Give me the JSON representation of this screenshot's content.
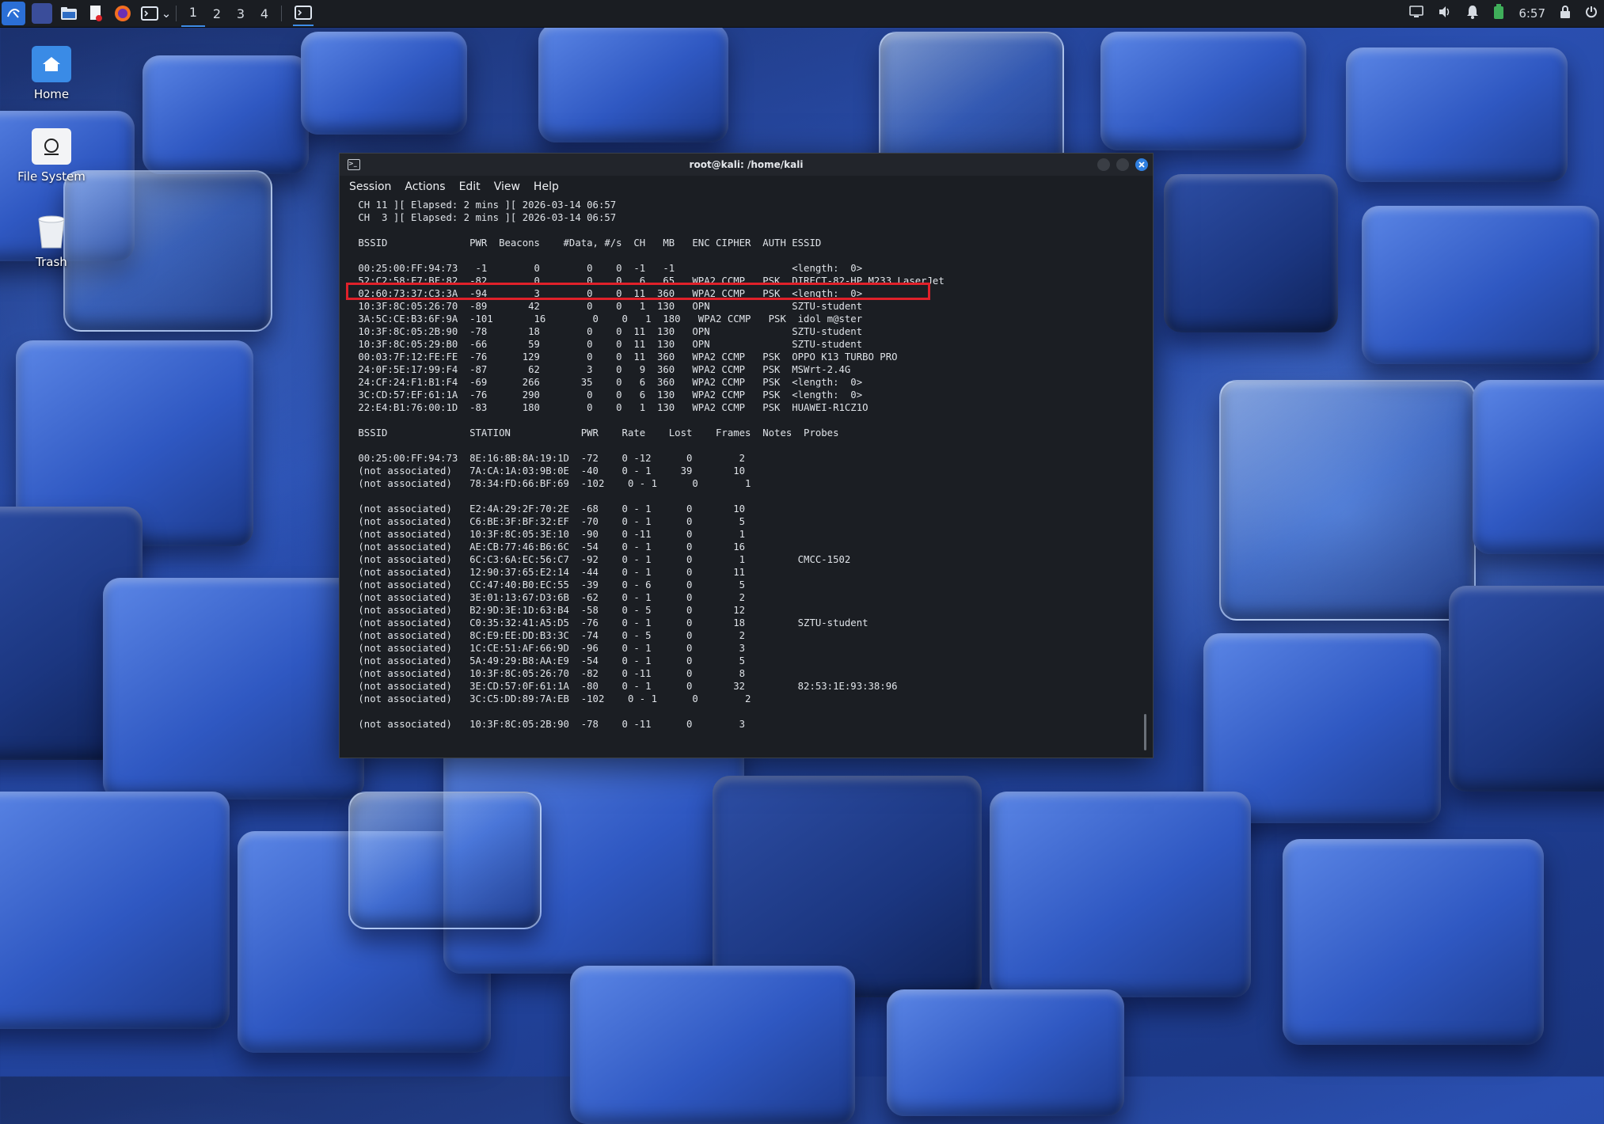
{
  "taskbar": {
    "workspaces": [
      "1",
      "2",
      "3",
      "4"
    ],
    "clock": "6:57"
  },
  "desktop": {
    "icons": [
      {
        "label": "Home"
      },
      {
        "label": "File System"
      },
      {
        "label": "Trash"
      }
    ]
  },
  "window": {
    "title": "root@kali: /home/kali",
    "menu": [
      "Session",
      "Actions",
      "Edit",
      "View",
      "Help"
    ]
  },
  "terminal": {
    "lines": [
      " CH 11 ][ Elapsed: 2 mins ][ 2026-03-14 06:57",
      " CH  3 ][ Elapsed: 2 mins ][ 2026-03-14 06:57",
      "",
      " BSSID              PWR  Beacons    #Data, #/s  CH   MB   ENC CIPHER  AUTH ESSID",
      "",
      " 00:25:00:FF:94:73   -1        0        0    0  -1   -1                    <length:  0>",
      " 52:C2:58:F7:BF:82  -82        0        0    0   6   65   WPA2 CCMP   PSK  DIRECT-82-HP M233 LaserJet",
      " 02:60:73:37:C3:3A  -94        3        0    0  11  360   WPA2 CCMP   PSK  <length:  0>",
      " 10:3F:8C:05:26:70  -89       42        0    0   1  130   OPN              SZTU-student",
      " 3A:5C:CE:B3:6F:9A  -101       16        0    0   1  180   WPA2 CCMP   PSK  idol m@ster",
      " 10:3F:8C:05:2B:90  -78       18        0    0  11  130   OPN              SZTU-student",
      " 10:3F:8C:05:29:B0  -66       59        0    0  11  130   OPN              SZTU-student",
      " 00:03:7F:12:FE:FE  -76      129        0    0  11  360   WPA2 CCMP   PSK  OPPO K13 TURBO PRO",
      " 24:0F:5E:17:99:F4  -87       62        3    0   9  360   WPA2 CCMP   PSK  MSWrt-2.4G",
      " 24:CF:24:F1:B1:F4  -69      266       35    0   6  360   WPA2 CCMP   PSK  <length:  0>",
      " 3C:CD:57:EF:61:1A  -76      290        0    0   6  130   WPA2 CCMP   PSK  <length:  0>",
      " 22:E4:B1:76:00:1D  -83      180        0    0   1  130   WPA2 CCMP   PSK  HUAWEI-R1CZ1O",
      "",
      " BSSID              STATION            PWR    Rate    Lost    Frames  Notes  Probes",
      "",
      " 00:25:00:FF:94:73  8E:16:8B:8A:19:1D  -72    0 -12      0        2",
      " (not associated)   7A:CA:1A:03:9B:0E  -40    0 - 1     39       10",
      " (not associated)   78:34:FD:66:BF:69  -102    0 - 1      0        1",
      "",
      " (not associated)   E2:4A:29:2F:70:2E  -68    0 - 1      0       10",
      " (not associated)   C6:BE:3F:BF:32:EF  -70    0 - 1      0        5",
      " (not associated)   10:3F:8C:05:3E:10  -90    0 -11      0        1",
      " (not associated)   AE:CB:77:46:B6:6C  -54    0 - 1      0       16",
      " (not associated)   6C:C3:6A:EC:56:C7  -92    0 - 1      0        1         CMCC-1502",
      " (not associated)   12:90:37:65:E2:14  -44    0 - 1      0       11",
      " (not associated)   CC:47:40:B0:EC:55  -39    0 - 6      0        5",
      " (not associated)   3E:01:13:67:D3:6B  -62    0 - 1      0        2",
      " (not associated)   B2:9D:3E:1D:63:B4  -58    0 - 5      0       12",
      " (not associated)   C0:35:32:41:A5:D5  -76    0 - 1      0       18         SZTU-student",
      " (not associated)   8C:E9:EE:DD:B3:3C  -74    0 - 5      0        2",
      " (not associated)   1C:CE:51:AF:66:9D  -96    0 - 1      0        3",
      " (not associated)   5A:49:29:B8:AA:E9  -54    0 - 1      0        5",
      " (not associated)   10:3F:8C:05:26:70  -82    0 -11      0        8",
      " (not associated)   3E:CD:57:0F:61:1A  -80    0 - 1      0       32         82:53:1E:93:38:96",
      " (not associated)   3C:C5:DD:89:7A:EB  -102    0 - 1      0        2",
      "",
      " (not associated)   10:3F:8C:05:2B:90  -78    0 -11      0        3"
    ]
  },
  "colors": {
    "highlight_box": "#e0212a",
    "close_button": "#2f7fe0",
    "terminal_bg": "#1b1e23"
  }
}
